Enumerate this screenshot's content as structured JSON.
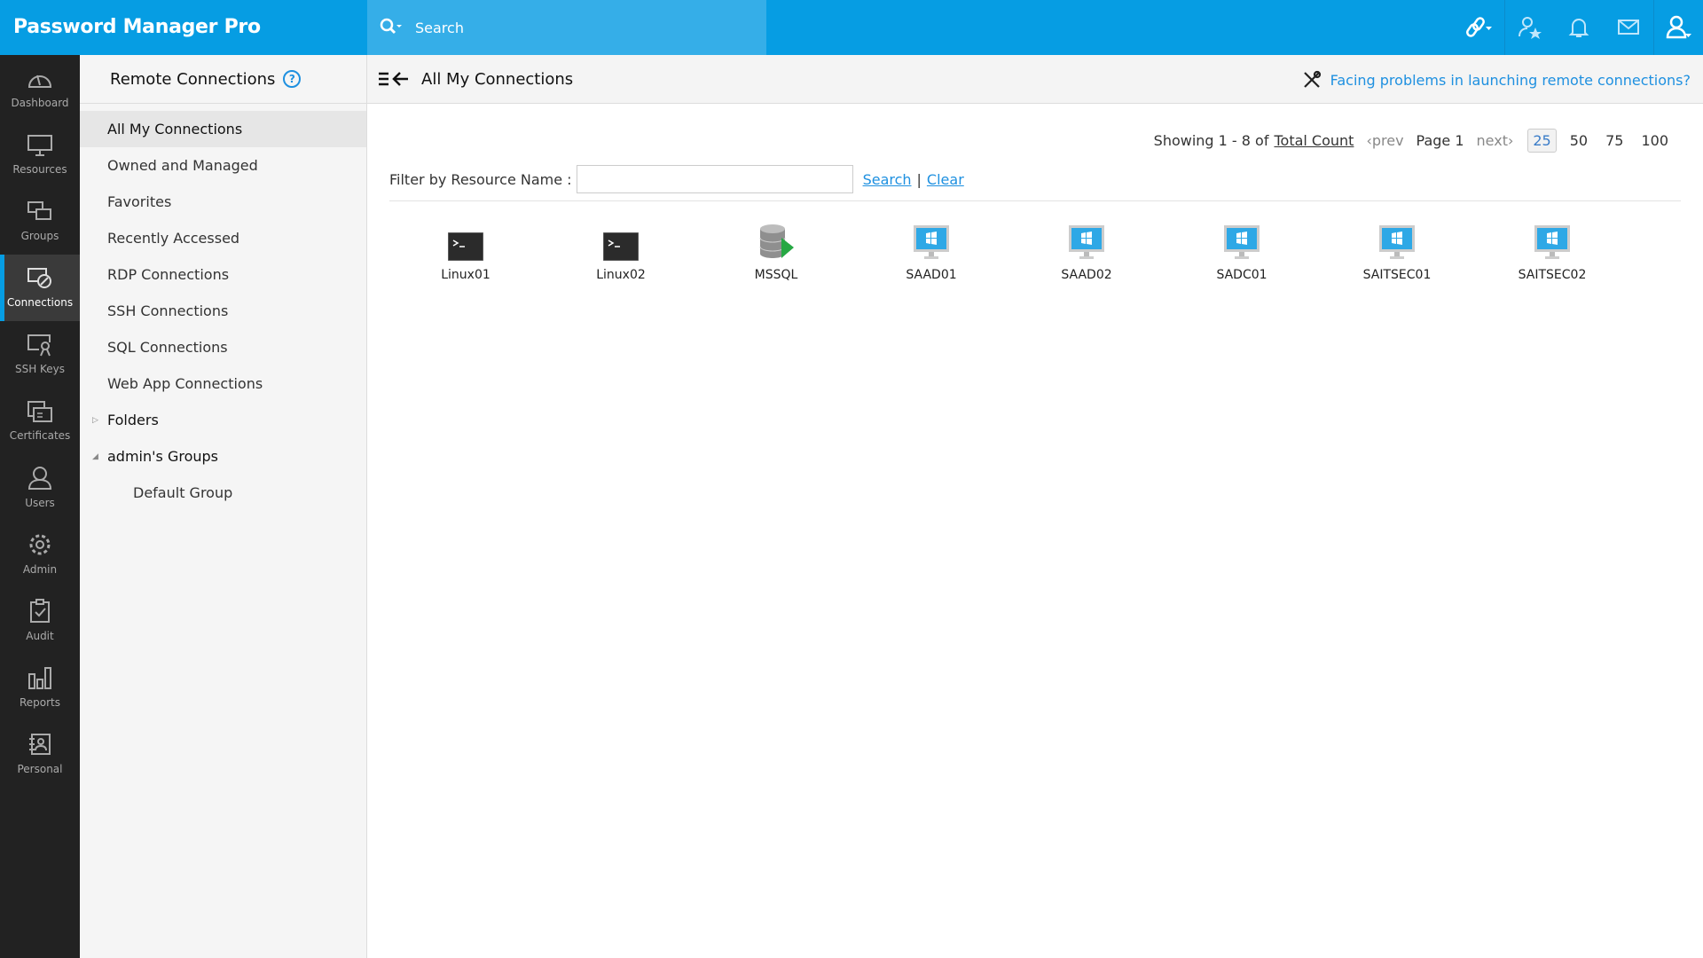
{
  "header": {
    "logo": "Password Manager Pro",
    "search_placeholder": "Search"
  },
  "sidebar": {
    "items": [
      {
        "label": "Dashboard",
        "icon": "dashboard-icon"
      },
      {
        "label": "Resources",
        "icon": "monitor-icon"
      },
      {
        "label": "Groups",
        "icon": "groups-icon"
      },
      {
        "label": "Connections",
        "icon": "connections-icon",
        "active": true
      },
      {
        "label": "SSH Keys",
        "icon": "ssh-key-icon"
      },
      {
        "label": "Certificates",
        "icon": "certificate-icon"
      },
      {
        "label": "Users",
        "icon": "user-icon"
      },
      {
        "label": "Admin",
        "icon": "gear-icon"
      },
      {
        "label": "Audit",
        "icon": "clipboard-check-icon"
      },
      {
        "label": "Reports",
        "icon": "bar-chart-icon"
      },
      {
        "label": "Personal",
        "icon": "contact-card-icon"
      }
    ]
  },
  "left_panel": {
    "title": "Remote Connections",
    "help": "?",
    "items": [
      "All My Connections",
      "Owned and Managed",
      "Favorites",
      "Recently Accessed",
      "RDP Connections",
      "SSH Connections",
      "SQL Connections",
      "Web App Connections"
    ],
    "folders": "Folders",
    "admin_groups": "admin's Groups",
    "default_group": "Default Group"
  },
  "main": {
    "title": "All My Connections",
    "trouble_link": "Facing problems in launching remote connections?",
    "pager": {
      "showing": "Showing 1 - 8 of",
      "total": "Total Count",
      "prev": "‹prev",
      "page": "Page 1",
      "next": "next›",
      "sizes": [
        "25",
        "50",
        "75",
        "100"
      ],
      "selected": "25"
    },
    "filter": {
      "label": "Filter by Resource Name :",
      "value": "",
      "search": "Search",
      "sep": "|",
      "clear": "Clear"
    },
    "resources": [
      {
        "name": "Linux01",
        "type": "terminal"
      },
      {
        "name": "Linux02",
        "type": "terminal"
      },
      {
        "name": "MSSQL",
        "type": "database"
      },
      {
        "name": "SAAD01",
        "type": "windows"
      },
      {
        "name": "SAAD02",
        "type": "windows"
      },
      {
        "name": "SADC01",
        "type": "windows"
      },
      {
        "name": "SAITSEC01",
        "type": "windows"
      },
      {
        "name": "SAITSEC02",
        "type": "windows"
      }
    ]
  },
  "colors": {
    "brand": "#069de3",
    "link": "#1e90e0"
  }
}
